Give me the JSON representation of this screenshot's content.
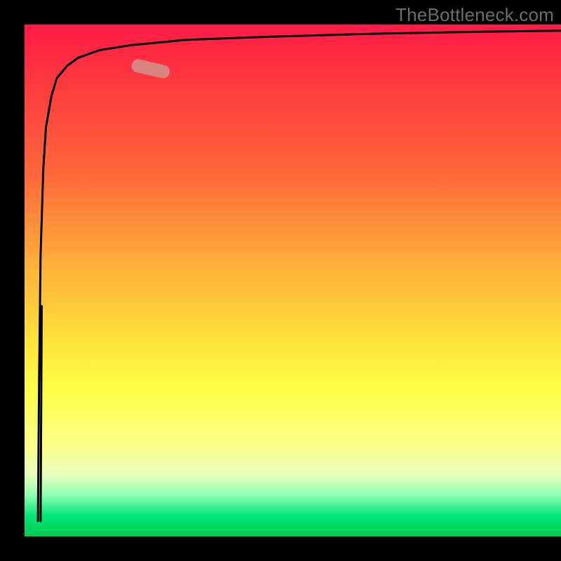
{
  "attribution": "TheBottleneck.com",
  "chart_data": {
    "type": "line",
    "title": "",
    "xlabel": "",
    "ylabel": "",
    "xlim": [
      0,
      100
    ],
    "ylim": [
      0,
      100
    ],
    "background_gradient_stops": [
      {
        "pos": 0,
        "color": "#ff1a46"
      },
      {
        "pos": 12,
        "color": "#ff3b3f"
      },
      {
        "pos": 30,
        "color": "#ff6a3a"
      },
      {
        "pos": 48,
        "color": "#ffb43a"
      },
      {
        "pos": 62,
        "color": "#ffe33a"
      },
      {
        "pos": 72,
        "color": "#ffff4a"
      },
      {
        "pos": 82,
        "color": "#fcff86"
      },
      {
        "pos": 88,
        "color": "#e8ffc0"
      },
      {
        "pos": 92,
        "color": "#8cffb0"
      },
      {
        "pos": 96,
        "color": "#00e676"
      },
      {
        "pos": 100,
        "color": "#00c853"
      }
    ],
    "series": [
      {
        "name": "bottleneck-curve",
        "color": "#000000",
        "x": [
          2.5,
          2.7,
          3.0,
          3.5,
          4.0,
          5.0,
          6.0,
          8.0,
          10.0,
          14.0,
          20.0,
          30.0,
          45.0,
          65.0,
          85.0,
          100.0
        ],
        "y": [
          3.0,
          30.0,
          55.0,
          72.0,
          80.0,
          86.0,
          89.5,
          92.0,
          93.5,
          95.0,
          96.0,
          97.0,
          97.6,
          98.2,
          98.6,
          98.8
        ]
      },
      {
        "name": "drop-line",
        "color": "#000000",
        "x": [
          3.2,
          3.0
        ],
        "y": [
          45.0,
          3.0
        ]
      }
    ],
    "marker": {
      "name": "highlight-pill",
      "x_range": [
        20.0,
        27.0
      ],
      "y_range": [
        90.5,
        92.2
      ],
      "color": "#d58b86"
    }
  }
}
